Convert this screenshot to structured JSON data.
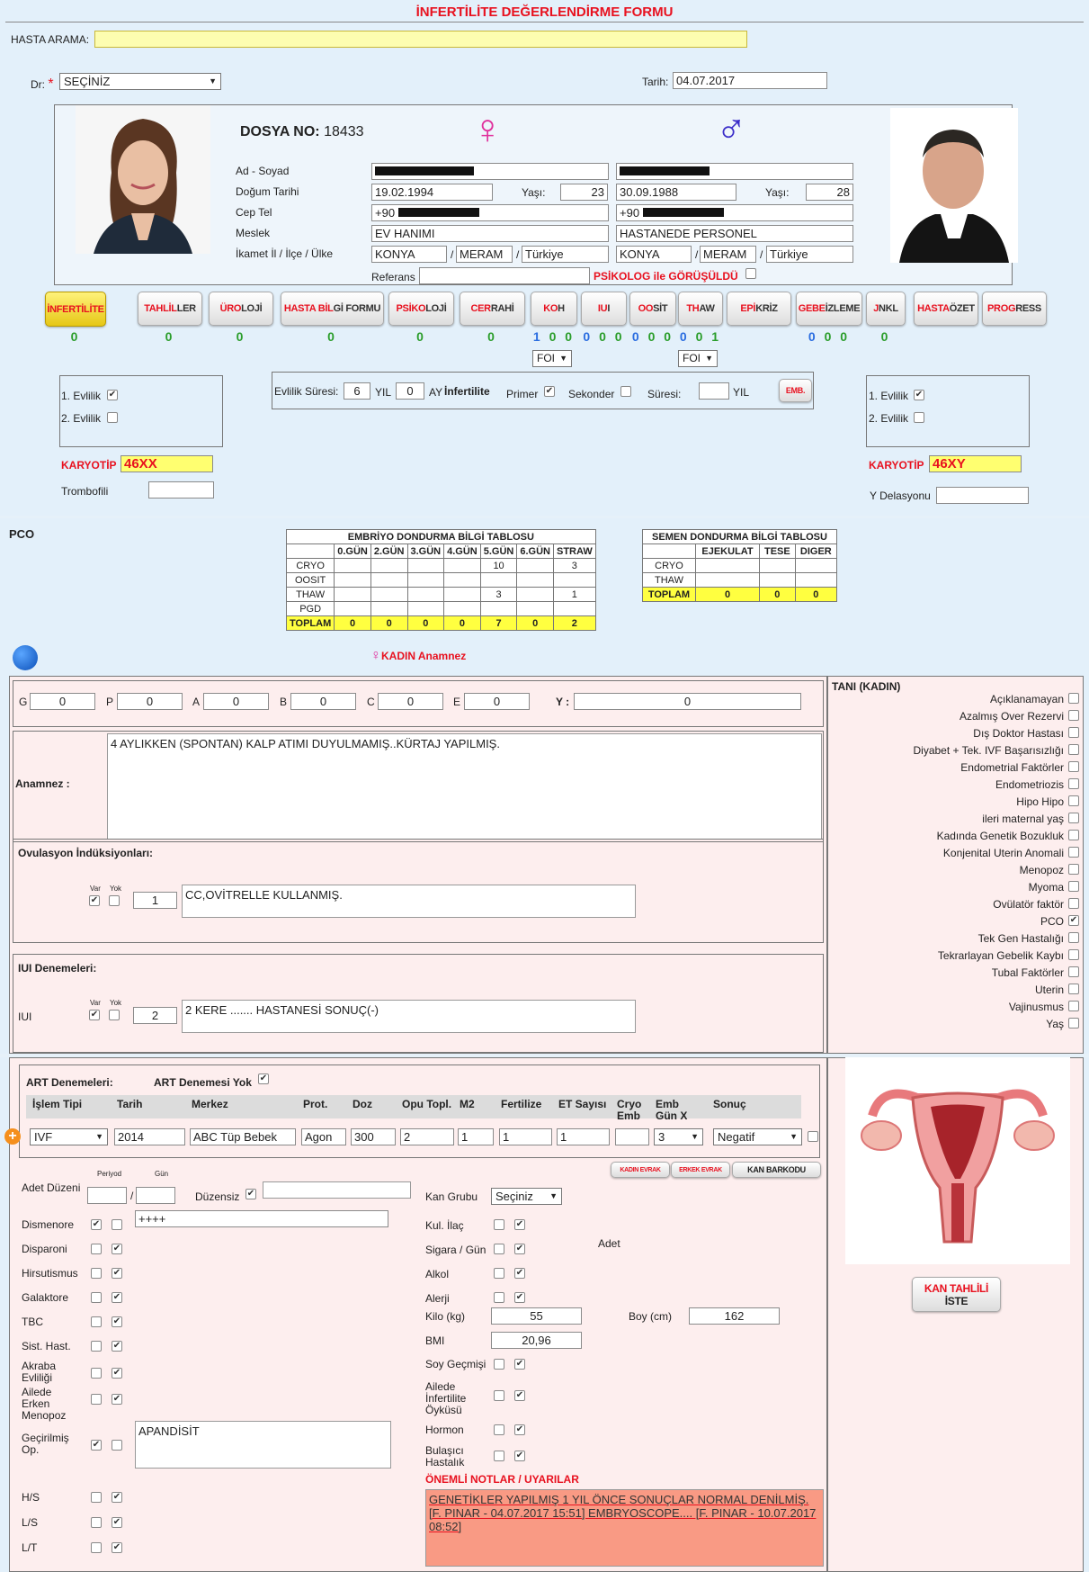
{
  "title": "İNFERTİLİTE DEĞERLENDİRME FORMU",
  "search": {
    "label": "HASTA ARAMA:",
    "value": ""
  },
  "doctor": {
    "label": "Dr:",
    "required": "*",
    "value": "SEÇİNİZ"
  },
  "date": {
    "label": "Tarih:",
    "value": "04.07.2017"
  },
  "dossier": {
    "label": "DOSYA NO:",
    "value": "18433"
  },
  "patient": {
    "labels": [
      "Ad - Soyad",
      "Doğum Tarihi",
      "Cep Tel",
      "Meslek",
      "İkamet İl / İlçe / Ülke"
    ],
    "age_label": "Yaşı:",
    "female": {
      "name": "",
      "dob": "19.02.1994",
      "age": "23",
      "phone": "+90",
      "job": "EV HANIMI",
      "city": "KONYA",
      "district": "MERAM",
      "country": "Türkiye"
    },
    "male": {
      "name": "",
      "dob": "30.09.1988",
      "age": "28",
      "phone": "+90",
      "job": "HASTANEDE PERSONEL",
      "city": "KONYA",
      "district": "MERAM",
      "country": "Türkiye"
    },
    "referans_label": "Referans",
    "psikolog_label": "PSİKOLOG ile GÖRÜŞÜLDÜ"
  },
  "tabs": [
    {
      "red": "İNFERTİLİTE",
      "rest": "",
      "count": "0",
      "active": true
    },
    {
      "red": "TAHLİL",
      "rest": "LER",
      "count": "0"
    },
    {
      "red": "ÜRO",
      "rest": "LOJİ",
      "count": "0"
    },
    {
      "red": "HASTA BİL",
      "rest": "Gİ FORMU",
      "count": "0"
    },
    {
      "red": "PSİKO",
      "rest": "LOJİ",
      "count": "0"
    },
    {
      "red": "CER",
      "rest": "RAHİ",
      "count": "0"
    },
    {
      "red": "KO",
      "rest": "H",
      "count": "1 0 0"
    },
    {
      "red": "IU",
      "rest": "I",
      "count": "0 0 0"
    },
    {
      "red": "OO",
      "rest": "SİT",
      "count": "0 0 0"
    },
    {
      "red": "TH",
      "rest": "AW",
      "count": "0 0 1"
    },
    {
      "red": "EPİ",
      "rest": "KRİZ",
      "count": ""
    },
    {
      "red": "GEBE",
      "rest": " İZLEME",
      "count": "0 0 0"
    },
    {
      "red": "J",
      "rest": "NKL",
      "count": "0"
    },
    {
      "red": "HASTA",
      "rest": " ÖZET",
      "count": ""
    },
    {
      "red": "PROG",
      "rest": "RESS",
      "count": ""
    }
  ],
  "foi": "FOI",
  "marriage": {
    "first": "1. Evlilik",
    "second": "2. Evlilik",
    "duration_label": "Evlilik Süresi:",
    "years": "6",
    "yil": "YIL",
    "months": "0",
    "ay": "AY",
    "infertilite": "İnfertilite",
    "primer": "Primer",
    "sekonder": "Sekonder",
    "suresi": "Süresi:",
    "emb": "EMB."
  },
  "karyotip": {
    "label": "KARYOTİP",
    "female": "46XX",
    "male": "46XY",
    "trombofili": "Trombofili",
    "y_del": "Y Delasyonu"
  },
  "pco_label": "PCO",
  "embryo_table": {
    "title": "EMBRİYO DONDURMA BİLGİ TABLOSU",
    "cols": [
      "0.GÜN",
      "2.GÜN",
      "3.GÜN",
      "4.GÜN",
      "5.GÜN",
      "6.GÜN",
      "STRAW"
    ],
    "rows": [
      [
        "CRYO",
        "",
        "",
        "",
        "",
        "10",
        "",
        "3"
      ],
      [
        "OOSIT",
        "",
        "",
        "",
        "",
        "",
        "",
        ""
      ],
      [
        "THAW",
        "",
        "",
        "",
        "",
        "3",
        "",
        "1"
      ],
      [
        "PGD",
        "",
        "",
        "",
        "",
        "",
        "",
        ""
      ]
    ],
    "total": [
      "TOPLAM",
      "0",
      "0",
      "0",
      "0",
      "7",
      "0",
      "2"
    ]
  },
  "semen_table": {
    "title": "SEMEN DONDURMA BİLGİ TABLOSU",
    "cols": [
      "EJEKULAT",
      "TESE",
      "DIGER"
    ],
    "rows": [
      [
        "CRYO",
        "",
        "",
        ""
      ],
      [
        "THAW",
        "",
        "",
        ""
      ]
    ],
    "total": [
      "TOPLAM",
      "0",
      "0",
      "0"
    ]
  },
  "kadin_anamnez": "KADIN Anamnez",
  "obstetric": {
    "G": "0",
    "P": "0",
    "A": "0",
    "B": "0",
    "C": "0",
    "E": "0",
    "Y": "0",
    "y_label": "Y :"
  },
  "anamnez": {
    "label": "Anamnez :",
    "text": "4 AYLIKKEN (SPONTAN) KALP ATIMI DUYULMAMIŞ..KÜRTAJ YAPILMIŞ."
  },
  "ovulasyon": {
    "label": "Ovulasyon İndüksiyonları:",
    "var": "Var",
    "yok": "Yok",
    "count": "1",
    "text": "CC,OVİTRELLE KULLANMIŞ."
  },
  "iui": {
    "label": "IUI Denemeleri:",
    "short": "IUI",
    "count": "2",
    "text": "2 KERE .......   HASTANESİ SONUÇ(-)"
  },
  "tani": {
    "title": "TANI (KADIN)",
    "items": [
      {
        "label": "Açıklanamayan",
        "checked": false
      },
      {
        "label": "Azalmış Over Rezervi",
        "checked": false
      },
      {
        "label": "Dış Doktor Hastası",
        "checked": false
      },
      {
        "label": "Diyabet + Tek. IVF Başarısızlığı",
        "checked": false
      },
      {
        "label": "Endometrial Faktörler",
        "checked": false
      },
      {
        "label": "Endometriozis",
        "checked": false
      },
      {
        "label": "Hipo Hipo",
        "checked": false
      },
      {
        "label": "ileri maternal yaş",
        "checked": false
      },
      {
        "label": "Kadında Genetik Bozukluk",
        "checked": false
      },
      {
        "label": "Konjenital Uterin Anomali",
        "checked": false
      },
      {
        "label": "Menopoz",
        "checked": false
      },
      {
        "label": "Myoma",
        "checked": false
      },
      {
        "label": "Ovülatör faktör",
        "checked": false
      },
      {
        "label": "PCO",
        "checked": true
      },
      {
        "label": "Tek Gen Hastalığı",
        "checked": false
      },
      {
        "label": "Tekrarlayan Gebelik Kaybı",
        "checked": false
      },
      {
        "label": "Tubal Faktörler",
        "checked": false
      },
      {
        "label": "Uterin",
        "checked": false
      },
      {
        "label": "Vajinusmus",
        "checked": false
      },
      {
        "label": "Yaş",
        "checked": false
      }
    ]
  },
  "art": {
    "label": "ART Denemeleri:",
    "none_label": "ART Denemesi Yok",
    "cols": [
      "İşlem Tipi",
      "Tarih",
      "Merkez",
      "Prot.",
      "Doz",
      "Opu Topl.",
      "M2",
      "Fertilize",
      "ET Sayısı",
      "Cryo Emb",
      "Emb Gün X",
      "Sonuç"
    ],
    "row": {
      "type": "IVF",
      "date": "2014",
      "center": "ABC Tüp Bebek",
      "prot": "Agon",
      "doz": "300",
      "opu": "2",
      "m2": "1",
      "fert": "1",
      "et": "1",
      "cryo": "",
      "gun": "3",
      "sonuc": "Negatif"
    }
  },
  "evrak": {
    "kadin": "KADIN EVRAK",
    "erkek": "ERKEK EVRAK",
    "kan": "KAN BARKODU"
  },
  "history": {
    "adet": "Adet Düzeni",
    "periyod": "Periyod",
    "gun": "Gün",
    "duzensiz": "Düzensiz",
    "dismenore_text": "++++",
    "geciris_text": "APANDİSİT",
    "left": [
      {
        "label": "Dismenore",
        "var": true,
        "yok": false
      },
      {
        "label": "Disparoni",
        "var": false,
        "yok": true
      },
      {
        "label": "Hirsutismus",
        "var": false,
        "yok": true
      },
      {
        "label": "Galaktore",
        "var": false,
        "yok": true
      },
      {
        "label": "TBC",
        "var": false,
        "yok": true
      },
      {
        "label": "Sist. Hast.",
        "var": false,
        "yok": true
      },
      {
        "label": "Akraba Evliliği",
        "var": false,
        "yok": true
      },
      {
        "label": "Ailede Erken Menopoz",
        "var": false,
        "yok": true
      },
      {
        "label": "Geçirilmiş Op.",
        "var": true,
        "yok": false
      },
      {
        "label": "H/S",
        "var": false,
        "yok": true
      },
      {
        "label": "L/S",
        "var": false,
        "yok": true
      },
      {
        "label": "L/T",
        "var": false,
        "yok": true
      }
    ],
    "kan_grubu": "Kan Grubu",
    "kan_value": "Seçiniz",
    "adet_label": "Adet",
    "right": [
      {
        "label": "Kul. İlaç"
      },
      {
        "label": "Sigara / Gün"
      },
      {
        "label": "Alkol"
      },
      {
        "label": "Alerji"
      }
    ],
    "kilo": "Kilo (kg)",
    "kilo_val": "55",
    "boy": "Boy (cm)",
    "boy_val": "162",
    "bmi": "BMI",
    "bmi_val": "20,96",
    "right2": [
      {
        "label": "Soy Geçmişi"
      },
      {
        "label": "Ailede İnfertilite Öyküsü"
      },
      {
        "label": "Hormon"
      },
      {
        "label": "Bulaşıcı Hastalık"
      }
    ],
    "notes_label": "ÖNEMLİ NOTLAR / UYARILAR",
    "notes_text": "GENETİKLER YAPILMIŞ 1 YIL ÖNCE SONUÇLAR NORMAL DENİLMİŞ. [F. PINAR - 04.07.2017 15:51] EMBRYOSCOPE.... [F. PINAR - 10.07.2017 08:52]"
  },
  "kan_tahlili": {
    "line1": "KAN TAHLİLİ",
    "line2": "İSTE"
  },
  "colors": {
    "red": "#e8111f",
    "yellow": "#ffff40",
    "notes": "#f99a84",
    "pink": "#fdeeee"
  }
}
